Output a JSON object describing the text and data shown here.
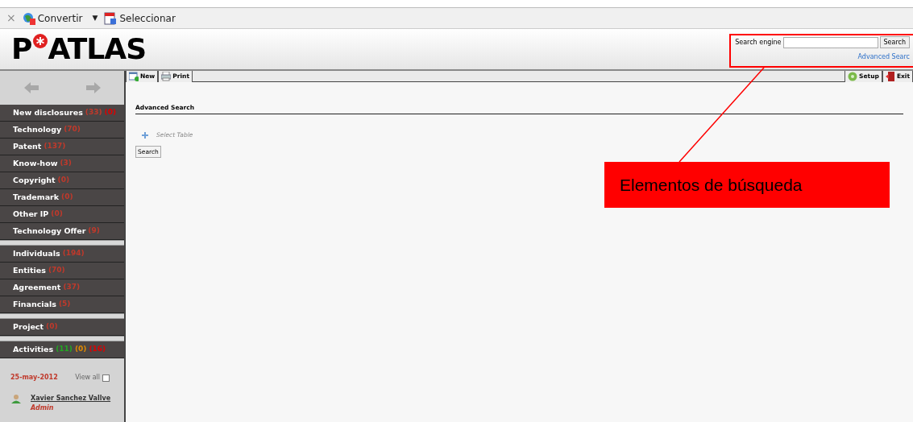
{
  "browser_toolbar": {
    "close": "×",
    "items": [
      {
        "label": "Convertir",
        "dropdown": "▼"
      },
      {
        "label": "Seleccionar"
      }
    ]
  },
  "logo": {
    "prefix": "P",
    "suffix": "ATLAS"
  },
  "search": {
    "label": "Search engine",
    "button": "Search",
    "link": "Advanced Searc"
  },
  "sidebar": {
    "groups": [
      [
        {
          "label": "New disclosures",
          "counts": [
            {
              "text": "(33)",
              "color": "#c0392b"
            },
            {
              "text": "(0)",
              "color": "#dd0000"
            }
          ]
        },
        {
          "label": "Technology",
          "counts": [
            {
              "text": "(70)",
              "color": "#c0392b"
            }
          ]
        },
        {
          "label": "Patent",
          "counts": [
            {
              "text": "(137)",
              "color": "#c0392b"
            }
          ]
        },
        {
          "label": "Know-how",
          "counts": [
            {
              "text": "(3)",
              "color": "#c0392b"
            }
          ]
        },
        {
          "label": "Copyright",
          "counts": [
            {
              "text": "(0)",
              "color": "#c0392b"
            }
          ]
        },
        {
          "label": "Trademark",
          "counts": [
            {
              "text": "(0)",
              "color": "#c0392b"
            }
          ]
        },
        {
          "label": "Other IP",
          "counts": [
            {
              "text": "(0)",
              "color": "#c0392b"
            }
          ]
        },
        {
          "label": "Technology Offer",
          "counts": [
            {
              "text": "(9)",
              "color": "#c0392b"
            }
          ]
        }
      ],
      [
        {
          "label": "Individuals",
          "counts": [
            {
              "text": "(194)",
              "color": "#c0392b"
            }
          ]
        },
        {
          "label": "Entities",
          "counts": [
            {
              "text": "(70)",
              "color": "#c0392b"
            }
          ]
        },
        {
          "label": "Agreement",
          "counts": [
            {
              "text": "(37)",
              "color": "#c0392b"
            }
          ]
        },
        {
          "label": "Financials",
          "counts": [
            {
              "text": "(5)",
              "color": "#c0392b"
            }
          ]
        }
      ],
      [
        {
          "label": "Project",
          "counts": [
            {
              "text": "(0)",
              "color": "#c0392b"
            }
          ]
        }
      ],
      [
        {
          "label": "Activities",
          "counts": [
            {
              "text": "(11)",
              "color": "#22a822"
            },
            {
              "text": "(0)",
              "color": "#e08a00"
            },
            {
              "text": "(16)",
              "color": "#dd0000"
            }
          ]
        }
      ]
    ],
    "date": "25-may-2012",
    "view_all": {
      "label": "View all",
      "checked": false
    },
    "user": {
      "name": "Xavier Sanchez Vallve",
      "role": "Admin"
    }
  },
  "toolbar": {
    "left": [
      {
        "label": "New",
        "kind": "new"
      },
      {
        "label": "Print",
        "kind": "print"
      }
    ],
    "right": [
      {
        "label": "Setup",
        "kind": "setup"
      },
      {
        "label": "Exit",
        "kind": "exit"
      }
    ]
  },
  "content": {
    "heading": "Advanced Search",
    "select_table": "Select Table",
    "button": "Search"
  },
  "annotation": {
    "label": "Elementos de búsqueda"
  }
}
